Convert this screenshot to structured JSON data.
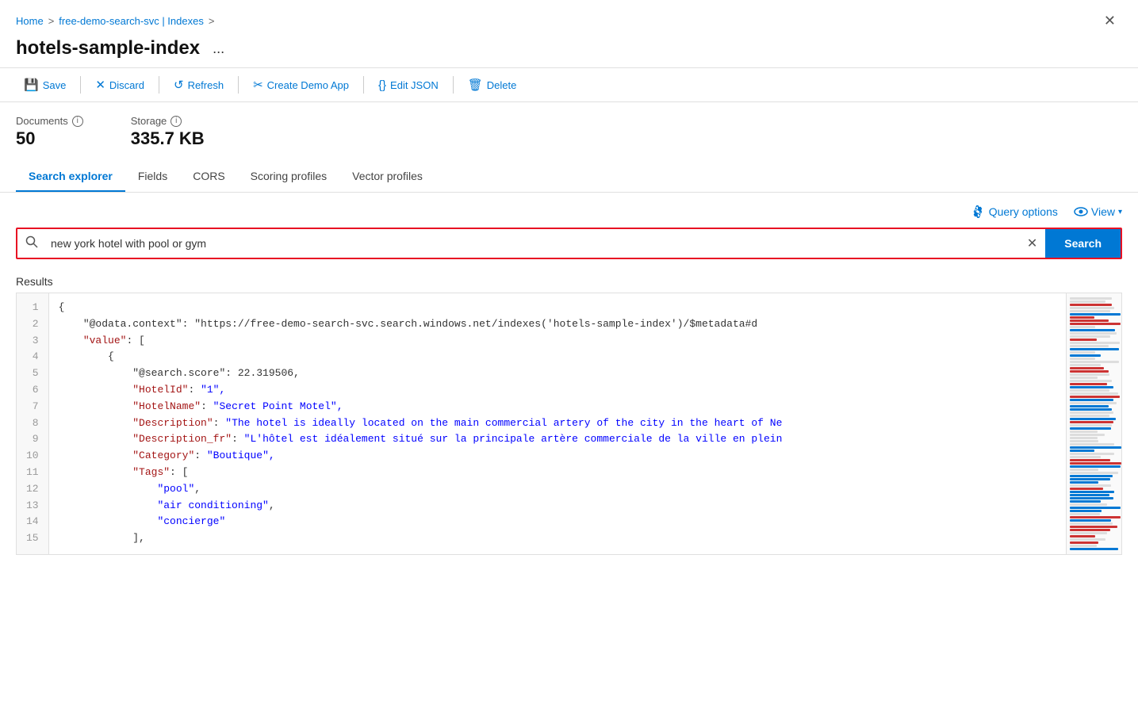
{
  "breadcrumb": {
    "home": "Home",
    "separator1": ">",
    "service": "free-demo-search-svc | Indexes",
    "separator2": ">"
  },
  "title": "hotels-sample-index",
  "ellipsis": "...",
  "toolbar": {
    "save": "Save",
    "discard": "Discard",
    "refresh": "Refresh",
    "createDemoApp": "Create Demo App",
    "editJson": "Edit JSON",
    "delete": "Delete"
  },
  "stats": {
    "documents_label": "Documents",
    "documents_value": "50",
    "storage_label": "Storage",
    "storage_value": "335.7 KB"
  },
  "tabs": [
    {
      "id": "search-explorer",
      "label": "Search explorer",
      "active": true
    },
    {
      "id": "fields",
      "label": "Fields",
      "active": false
    },
    {
      "id": "cors",
      "label": "CORS",
      "active": false
    },
    {
      "id": "scoring-profiles",
      "label": "Scoring profiles",
      "active": false
    },
    {
      "id": "vector-profiles",
      "label": "Vector profiles",
      "active": false
    }
  ],
  "query_options_label": "Query options",
  "view_label": "View",
  "search_placeholder": "new york hotel with pool or gym",
  "search_value": "new york hotel with pool or gym",
  "search_button": "Search",
  "results_label": "Results",
  "code_lines": [
    {
      "num": 1,
      "text": "{"
    },
    {
      "num": 2,
      "text": "    \"@odata.context\": \"https://free-demo-search-svc.search.windows.net/indexes('hotels-sample-index')/$metadata#d"
    },
    {
      "num": 3,
      "text": "    \"value\": ["
    },
    {
      "num": 4,
      "text": "        {"
    },
    {
      "num": 5,
      "text": "            \"@search.score\": 22.319506,"
    },
    {
      "num": 6,
      "text": "            \"HotelId\": \"1\","
    },
    {
      "num": 7,
      "text": "            \"HotelName\": \"Secret Point Motel\","
    },
    {
      "num": 8,
      "text": "            \"Description\": \"The hotel is ideally located on the main commercial artery of the city in the heart of Ne"
    },
    {
      "num": 9,
      "text": "            \"Description_fr\": \"L'hôtel est idéalement situé sur la principale artère commerciale de la ville en plein"
    },
    {
      "num": 10,
      "text": "            \"Category\": \"Boutique\","
    },
    {
      "num": 11,
      "text": "            \"Tags\": ["
    },
    {
      "num": 12,
      "text": "                \"pool\","
    },
    {
      "num": 13,
      "text": "                \"air conditioning\","
    },
    {
      "num": 14,
      "text": "                \"concierge\""
    },
    {
      "num": 15,
      "text": "            ],"
    }
  ]
}
